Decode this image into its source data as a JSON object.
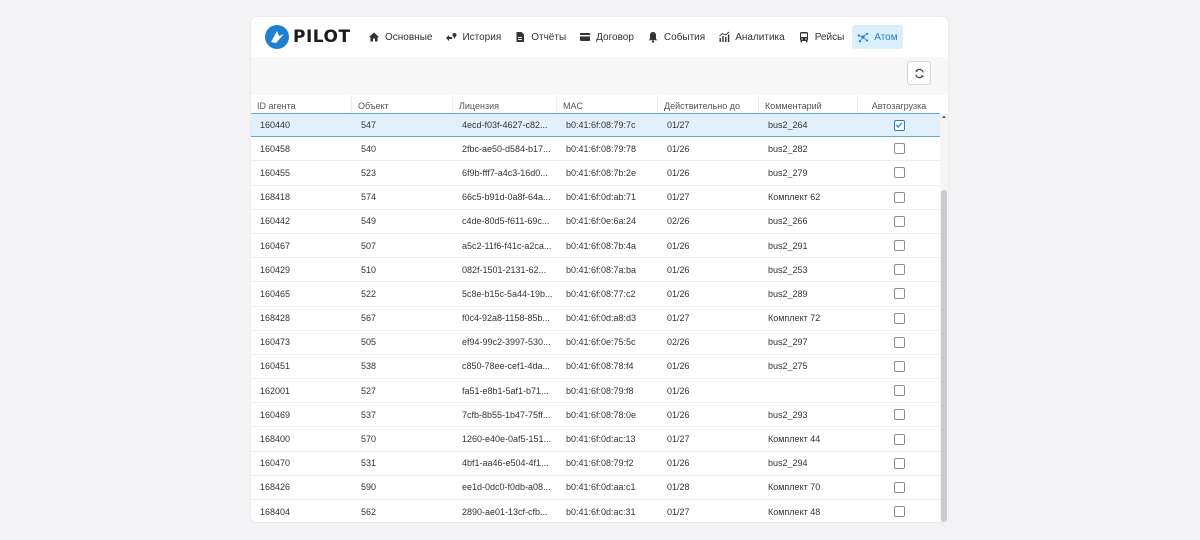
{
  "app": {
    "logo_text": "PILOT"
  },
  "nav": [
    {
      "label": "Основные",
      "icon": "home-icon"
    },
    {
      "label": "История",
      "icon": "route-icon"
    },
    {
      "label": "Отчёты",
      "icon": "file-icon"
    },
    {
      "label": "Договор",
      "icon": "card-icon"
    },
    {
      "label": "События",
      "icon": "bell-icon"
    },
    {
      "label": "Аналитика",
      "icon": "chart-icon"
    },
    {
      "label": "Рейсы",
      "icon": "bus-icon"
    },
    {
      "label": "Атом",
      "icon": "network-icon",
      "active": true
    }
  ],
  "toolbar": {
    "refresh_icon": "refresh-icon"
  },
  "table": {
    "columns": [
      "ID агента",
      "Объект",
      "Лицензия",
      "MAC",
      "Действительно до",
      "Комментарий",
      "Автозагрузка"
    ],
    "rows": [
      {
        "id": "160440",
        "obj": "547",
        "lic": "4ecd-f03f-4627-c82...",
        "mac": "b0:41:6f:08:79:7c",
        "until": "01/27",
        "comment": "bus2_264",
        "autoload": true,
        "selected": true
      },
      {
        "id": "160458",
        "obj": "540",
        "lic": "2fbc-ae50-d584-b17...",
        "mac": "b0:41:6f:08:79:78",
        "until": "01/26",
        "comment": "bus2_282",
        "autoload": false
      },
      {
        "id": "160455",
        "obj": "523",
        "lic": "6f9b-fff7-a4c3-16d0...",
        "mac": "b0:41:6f:08:7b:2e",
        "until": "01/26",
        "comment": "bus2_279",
        "autoload": false
      },
      {
        "id": "168418",
        "obj": "574",
        "lic": "66c5-b91d-0a8f-64a...",
        "mac": "b0:41:6f:0d:ab:71",
        "until": "01/27",
        "comment": "Комплект 62",
        "autoload": false
      },
      {
        "id": "160442",
        "obj": "549",
        "lic": "c4de-80d5-f611-69c...",
        "mac": "b0:41:6f:0e:6a:24",
        "until": "02/26",
        "comment": "bus2_266",
        "autoload": false
      },
      {
        "id": "160467",
        "obj": "507",
        "lic": "a5c2-11f6-f41c-a2ca...",
        "mac": "b0:41:6f:08:7b:4a",
        "until": "01/26",
        "comment": "bus2_291",
        "autoload": false
      },
      {
        "id": "160429",
        "obj": "510",
        "lic": "082f-1501-2131-62...",
        "mac": "b0:41:6f:08:7a:ba",
        "until": "01/26",
        "comment": "bus2_253",
        "autoload": false
      },
      {
        "id": "160465",
        "obj": "522",
        "lic": "5c8e-b15c-5a44-19b...",
        "mac": "b0:41:6f:08:77:c2",
        "until": "01/26",
        "comment": "bus2_289",
        "autoload": false
      },
      {
        "id": "168428",
        "obj": "567",
        "lic": "f0c4-92a8-1158-85b...",
        "mac": "b0:41:6f:0d:a8:d3",
        "until": "01/27",
        "comment": "Комплект 72",
        "autoload": false
      },
      {
        "id": "160473",
        "obj": "505",
        "lic": "ef94-99c2-3997-530...",
        "mac": "b0:41:6f:0e:75:5c",
        "until": "02/26",
        "comment": "bus2_297",
        "autoload": false
      },
      {
        "id": "160451",
        "obj": "538",
        "lic": "c850-78ee-cef1-4da...",
        "mac": "b0:41:6f:08:78:f4",
        "until": "01/26",
        "comment": "bus2_275",
        "autoload": false
      },
      {
        "id": "162001",
        "obj": "527",
        "lic": "fa51-e8b1-5af1-b71...",
        "mac": "b0:41:6f:08:79:f8",
        "until": "01/26",
        "comment": "",
        "autoload": false
      },
      {
        "id": "160469",
        "obj": "537",
        "lic": "7cfb-8b55-1b47-75ff...",
        "mac": "b0:41:6f:08:78:0e",
        "until": "01/26",
        "comment": "bus2_293",
        "autoload": false
      },
      {
        "id": "168400",
        "obj": "570",
        "lic": "1260-e40e-0af5-151...",
        "mac": "b0:41:6f:0d:ac:13",
        "until": "01/27",
        "comment": "Комплект 44",
        "autoload": false
      },
      {
        "id": "160470",
        "obj": "531",
        "lic": "4bf1-aa46-e504-4f1...",
        "mac": "b0:41:6f:08:79:f2",
        "until": "01/26",
        "comment": "bus2_294",
        "autoload": false
      },
      {
        "id": "168426",
        "obj": "590",
        "lic": "ee1d-0dc0-f0db-a08...",
        "mac": "b0:41:6f:0d:aa:c1",
        "until": "01/28",
        "comment": "Комплект 70",
        "autoload": false
      },
      {
        "id": "168404",
        "obj": "562",
        "lic": "2890-ae01-13cf-cfb...",
        "mac": "b0:41:6f:0d:ac:31",
        "until": "01/27",
        "comment": "Комплект 48",
        "autoload": false
      }
    ]
  },
  "colors": {
    "accent": "#1f7fd0",
    "selected_row": "#e2f0fb",
    "background": "#f3f3f5"
  }
}
